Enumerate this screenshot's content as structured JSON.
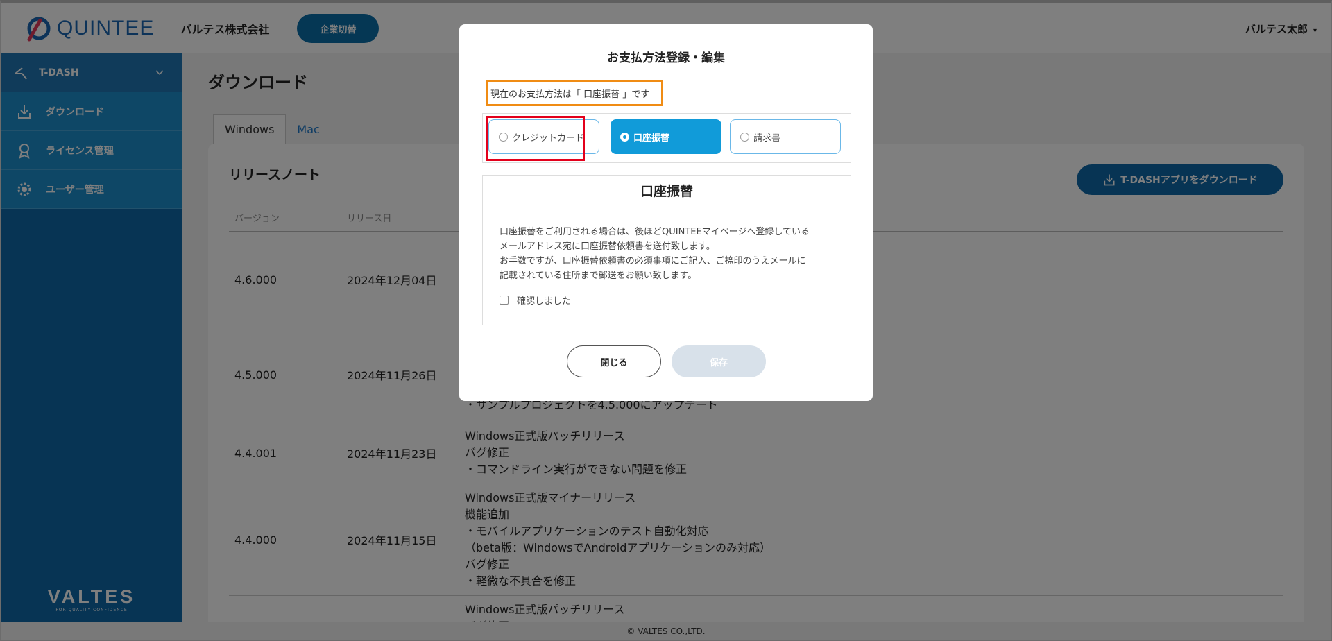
{
  "header": {
    "logo_text": "QUINTEE",
    "company_name": "バルテス株式会社",
    "switch_button": "企業切替",
    "user_name": "バルテス太郎",
    "user_caret": "▾"
  },
  "sidebar": {
    "section_label": "T-DASH",
    "items": [
      {
        "label": "ダウンロード"
      },
      {
        "label": "ライセンス管理"
      },
      {
        "label": "ユーザー管理"
      }
    ],
    "brand": "VALTES",
    "brand_tagline": "FOR QUALITY CONFIDENCE"
  },
  "main": {
    "page_title": "ダウンロード",
    "tabs": [
      {
        "label": "Windows",
        "active": true
      },
      {
        "label": "Mac",
        "active": false
      }
    ],
    "release_notes_title": "リリースノート",
    "download_button": "T-DASHアプリをダウンロード",
    "columns": {
      "version": "バージョン",
      "date": "リリース日"
    },
    "rows": [
      {
        "version": "4.6.000",
        "date": "2024年12月04日",
        "notes": []
      },
      {
        "version": "4.5.000",
        "date": "2024年11月26日",
        "notes": [
          "",
          "",
          "",
          "・サンプルプロジェクトを4.5.000にアップデート"
        ]
      },
      {
        "version": "4.4.001",
        "date": "2024年11月23日",
        "notes": [
          "Windows正式版パッチリリース",
          "バグ修正",
          "・コマンドライン実行ができない問題を修正"
        ]
      },
      {
        "version": "4.4.000",
        "date": "2024年11月15日",
        "notes": [
          "Windows正式版マイナーリリース",
          "機能追加",
          "・モバイルアプリケーションのテスト自動化対応",
          "（beta版：WindowsでAndroidアプリケーションのみ対応）",
          "バグ修正",
          "・軽微な不具合を修正"
        ]
      },
      {
        "version": "",
        "date": "",
        "notes": [
          "Windows正式版パッチリリース",
          "バグ修正"
        ]
      }
    ]
  },
  "footer": {
    "copyright": "© VALTES CO.,LTD."
  },
  "modal": {
    "title": "お支払方法登録・編集",
    "current_method": "現在のお支払方法は「 口座振替 」です",
    "options": [
      {
        "label": "クレジットカード",
        "selected": false
      },
      {
        "label": "口座振替",
        "selected": true
      },
      {
        "label": "請求書",
        "selected": false
      }
    ],
    "info_title": "口座振替",
    "info_lines": [
      "口座振替をご利用される場合は、後ほどQUINTEEマイページへ登録している",
      "メールアドレス宛に口座振替依頼書を送付致します。",
      "お手数ですが、口座振替依頼書の必須事項にご記入、ご捺印のうえメールに",
      "記載されている住所まで郵送をお願い致します。"
    ],
    "confirm_label": "確認しました",
    "close_button": "閉じる",
    "save_button": "保存"
  },
  "colors": {
    "brand_blue": "#0f68a8",
    "accent_blue": "#119bd9",
    "highlight_orange": "#f08c14",
    "highlight_red": "#e3001b"
  }
}
